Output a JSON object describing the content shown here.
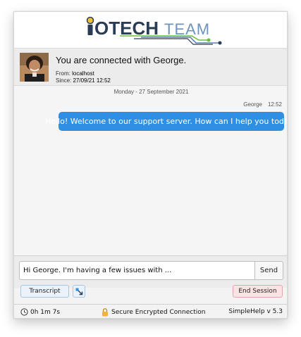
{
  "logo": {
    "text_bold": "OTECH",
    "text_light": "TEAM"
  },
  "connection": {
    "title": "You are connected with George.",
    "from_label": "From:",
    "from_value": "localhost",
    "since_label": "Since:",
    "since_value": "27/09/21 12:52"
  },
  "chat": {
    "date_separator": "Monday  -  27 September 2021",
    "messages": [
      {
        "sender": "George",
        "time": "12:52",
        "text": "Hello! Welcome to our support server. How can I help you today?"
      }
    ]
  },
  "composer": {
    "input_value": "Hi George. I'm having a few issues with ...",
    "send_label": "Send"
  },
  "buttons": {
    "transcript_label": "Transcript",
    "end_session_label": "End Session"
  },
  "status_bar": {
    "timer": "0h 1m 7s",
    "security": "Secure Encrypted Connection",
    "version": "SimpleHelp v 5.3"
  },
  "colors": {
    "bubble": "#2f8fe5",
    "logo_dark": "#2a3d55",
    "logo_green": "#6bbf3f",
    "logo_blue": "#5b83b7",
    "end_session_bg": "#fbe3e3",
    "transcript_bg": "#eaf2fb"
  },
  "icons": [
    "lightbulb-icon",
    "clock-icon",
    "lock-icon",
    "popout-icon"
  ]
}
